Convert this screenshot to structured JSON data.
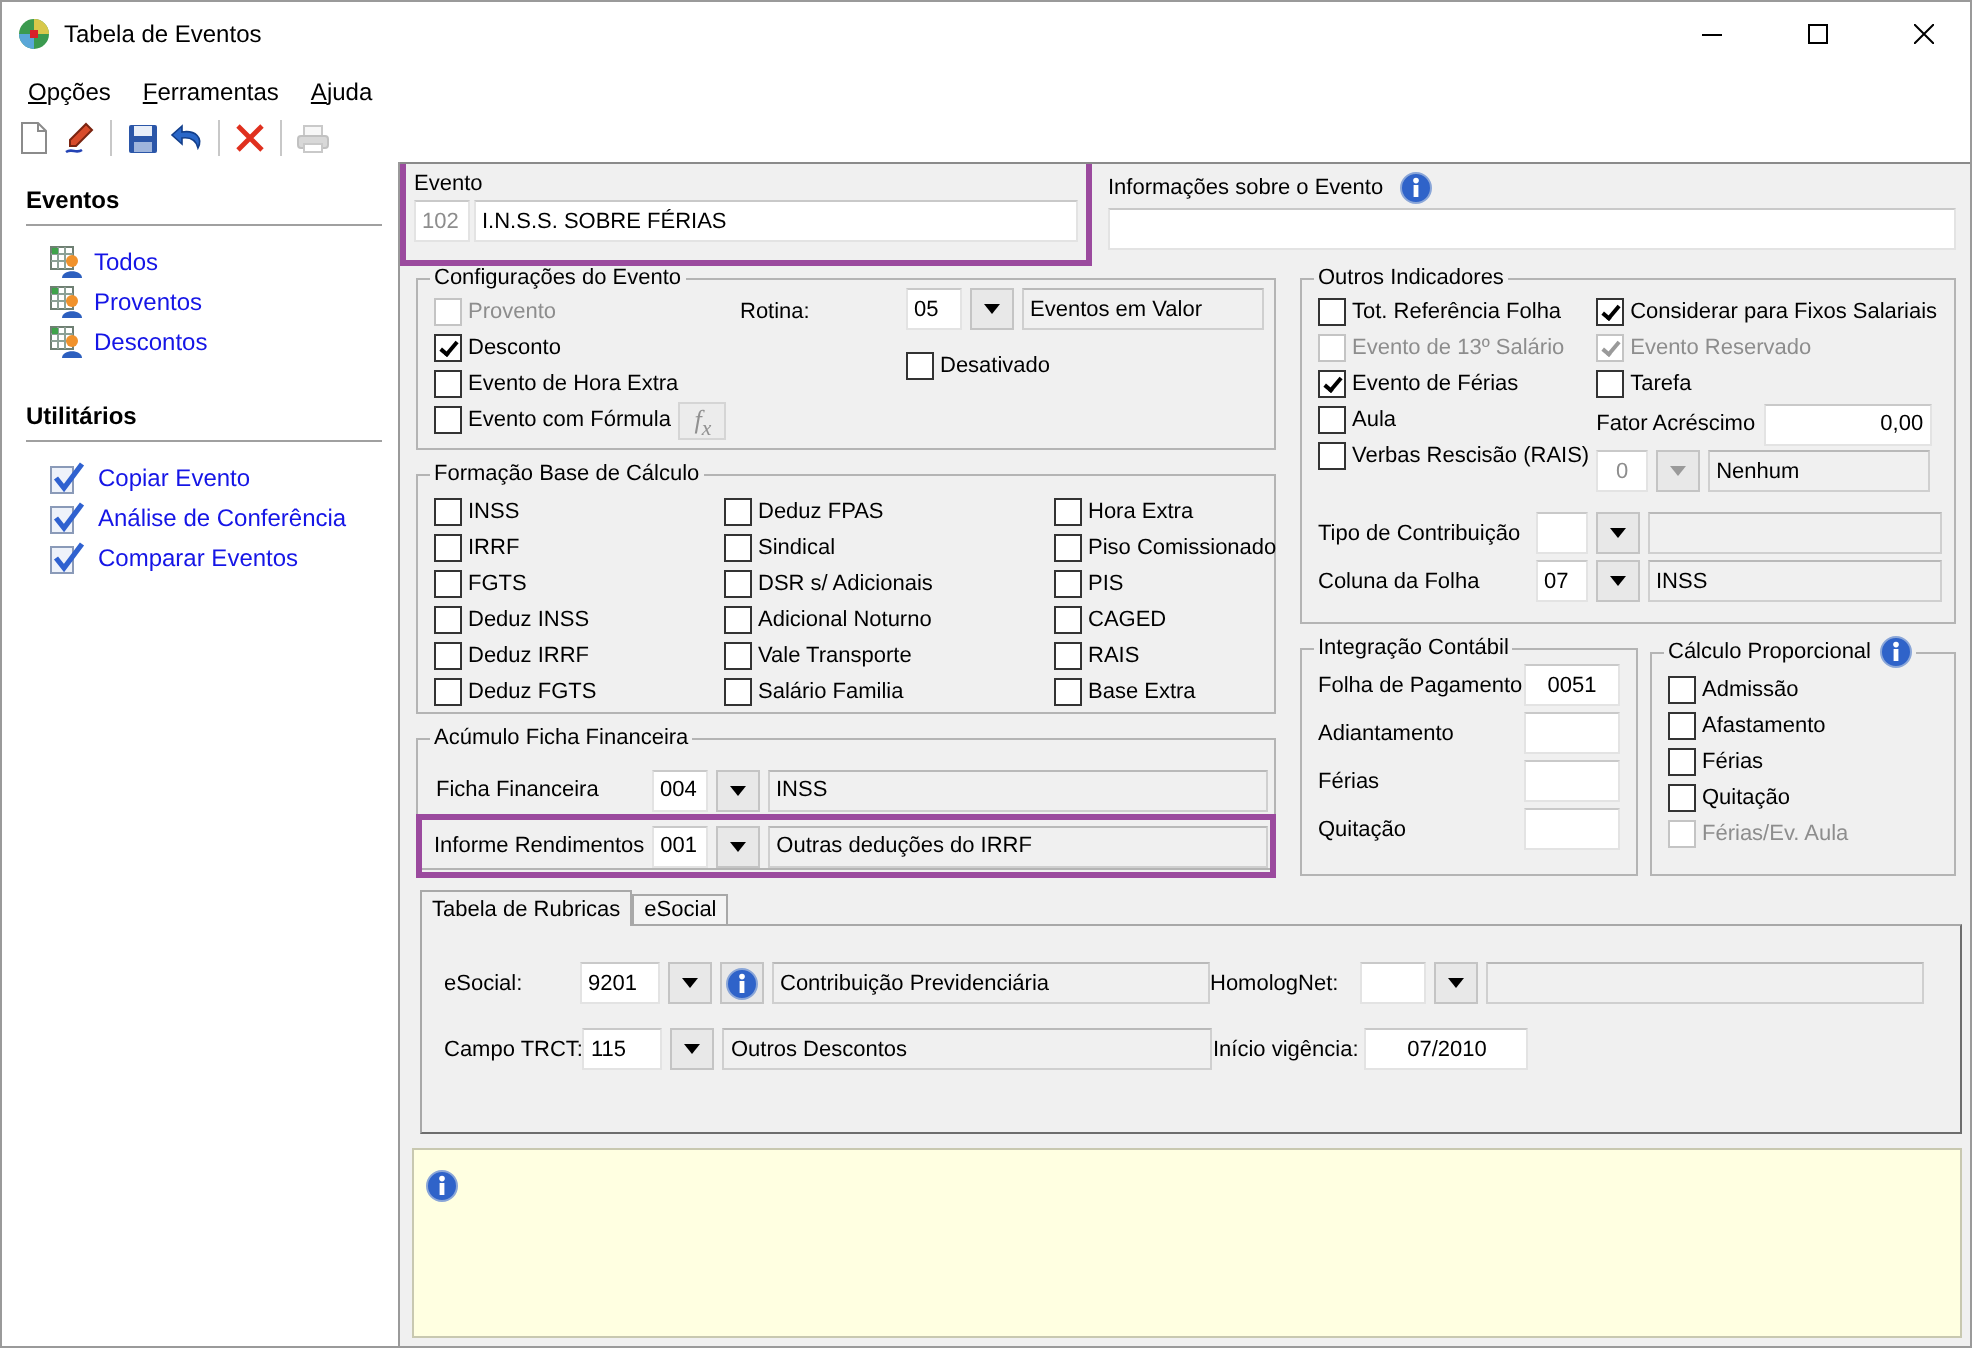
{
  "window": {
    "title": "Tabela de Eventos"
  },
  "menu": [
    {
      "label": "Opções"
    },
    {
      "label": "Ferramentas"
    },
    {
      "label": "Ajuda"
    }
  ],
  "toolbar": [
    {
      "kind": "new",
      "disabled": false
    },
    {
      "kind": "edit",
      "disabled": false
    },
    {
      "kind": "separator"
    },
    {
      "kind": "save",
      "disabled": false
    },
    {
      "kind": "undo",
      "disabled": false
    },
    {
      "kind": "separator"
    },
    {
      "kind": "delete",
      "disabled": false
    },
    {
      "kind": "separator"
    },
    {
      "kind": "print",
      "disabled": true
    }
  ],
  "sidebar": [
    {
      "title": "Eventos",
      "kind": "events",
      "items": [
        {
          "label": "Todos"
        },
        {
          "label": "Proventos"
        },
        {
          "label": "Descontos"
        }
      ]
    },
    {
      "title": "Utilitários",
      "kind": "tools",
      "items": [
        {
          "label": "Copiar Evento"
        },
        {
          "label": "Análise de Conferência"
        },
        {
          "label": "Comparar Eventos"
        }
      ]
    }
  ],
  "evento": {
    "label": "Evento",
    "code": "102",
    "name": "I.N.S.S. SOBRE FÉRIAS",
    "highlighted": true
  },
  "informacoes": {
    "label": "Informações sobre o Evento"
  },
  "configuracoes": {
    "title": "Configurações do Evento",
    "options": [
      {
        "label": "Provento",
        "checked": false,
        "disabled": true,
        "kind": "plain"
      },
      {
        "label": "Desconto",
        "checked": true,
        "disabled": false,
        "kind": "plain"
      },
      {
        "label": "Evento de Hora Extra",
        "checked": false,
        "disabled": false,
        "kind": "plain"
      },
      {
        "label": "Evento com Fórmula",
        "checked": false,
        "disabled": false,
        "kind": "formula",
        "button": "f$_{x}$"
      }
    ],
    "rotina": {
      "label": "Rotina:",
      "code": "05",
      "description": "Eventos em Valor"
    },
    "desativado": {
      "label": "Desativado",
      "checked": false
    }
  },
  "base_calculo": {
    "title": "Formação Base de Cálculo",
    "columns": [
      [
        {
          "label": "INSS",
          "checked": false
        },
        {
          "label": "IRRF",
          "checked": false
        },
        {
          "label": "FGTS",
          "checked": false
        },
        {
          "label": "Deduz INSS",
          "checked": false
        },
        {
          "label": "Deduz IRRF",
          "checked": false
        },
        {
          "label": "Deduz FGTS",
          "checked": false
        }
      ],
      [
        {
          "label": "Deduz FPAS",
          "checked": false
        },
        {
          "label": "Sindical",
          "checked": false
        },
        {
          "label": "DSR s/ Adicionais",
          "checked": false
        },
        {
          "label": "Adicional Noturno",
          "checked": false
        },
        {
          "label": "Vale Transporte",
          "checked": false
        },
        {
          "label": "Salário Familia",
          "checked": false
        }
      ],
      [
        {
          "label": "Hora Extra",
          "checked": false
        },
        {
          "label": "Piso Comissionado",
          "checked": false
        },
        {
          "label": "PIS",
          "checked": false
        },
        {
          "label": "CAGED",
          "checked": false
        },
        {
          "label": "RAIS",
          "checked": false
        },
        {
          "label": "Base Extra",
          "checked": false
        }
      ]
    ]
  },
  "acumulo": {
    "title": "Acúmulo Ficha Financeira",
    "rows": [
      {
        "label": "Ficha Financeira",
        "code": "004",
        "description": "INSS",
        "highlighted": false
      },
      {
        "label": "Informe Rendimentos",
        "code": "001",
        "description": "Outras deduções do IRRF",
        "highlighted": true
      }
    ]
  },
  "outros": {
    "title": "Outros Indicadores",
    "left": [
      {
        "label": "Tot. Referência Folha",
        "checked": false,
        "disabled": false
      },
      {
        "label": "Evento de 13º Salário",
        "checked": false,
        "disabled": true
      },
      {
        "label": "Evento de Férias",
        "checked": true,
        "disabled": false
      },
      {
        "label": "Aula",
        "checked": false,
        "disabled": false
      },
      {
        "label": "Verbas Rescisão (RAIS)",
        "checked": false,
        "disabled": false
      }
    ],
    "right": [
      {
        "label": "Considerar para Fixos Salariais",
        "checked": true,
        "disabled": false
      },
      {
        "label": "Evento Reservado",
        "checked": true,
        "disabled": true
      },
      {
        "label": "Tarefa",
        "checked": false,
        "disabled": false
      }
    ],
    "fator": {
      "label": "Fator Acréscimo",
      "value": "0,00"
    },
    "selector": {
      "code": "0",
      "description": "Nenhum",
      "disabled": true
    },
    "rows": [
      {
        "label": "Tipo de Contribuição"
      },
      {
        "label": "Coluna da Folha",
        "code": "07",
        "description": "INSS"
      }
    ]
  },
  "integracao": {
    "title": "Integração Contábil",
    "rows": [
      {
        "label": "Folha de Pagamento",
        "value": "0051"
      },
      {
        "label": "Adiantamento"
      },
      {
        "label": "Férias"
      },
      {
        "label": "Quitação"
      }
    ]
  },
  "proporcional": {
    "title": "Cálculo Proporcional",
    "options": [
      {
        "label": "Admissão",
        "checked": false,
        "disabled": false
      },
      {
        "label": "Afastamento",
        "checked": false,
        "disabled": false
      },
      {
        "label": "Férias",
        "checked": false,
        "disabled": false
      },
      {
        "label": "Quitação",
        "checked": false,
        "disabled": false
      },
      {
        "label": "Férias/Ev. Aula",
        "checked": false,
        "disabled": true
      }
    ]
  },
  "tabs": [
    {
      "label": "Tabela de Rubricas",
      "selected": true
    },
    {
      "label": "eSocial",
      "selected": false
    }
  ],
  "rubricas": {
    "esocial": {
      "label": "eSocial:",
      "code": "9201",
      "description": "Contribuição Previdenciária"
    },
    "campo_trct": {
      "label": "Campo TRCT:",
      "code": "115",
      "description": "Outros Descontos"
    },
    "homolognet": {
      "label": "HomologNet:"
    },
    "inicio_vigencia": {
      "label": "Início vigência:",
      "value": "07/2010"
    }
  }
}
